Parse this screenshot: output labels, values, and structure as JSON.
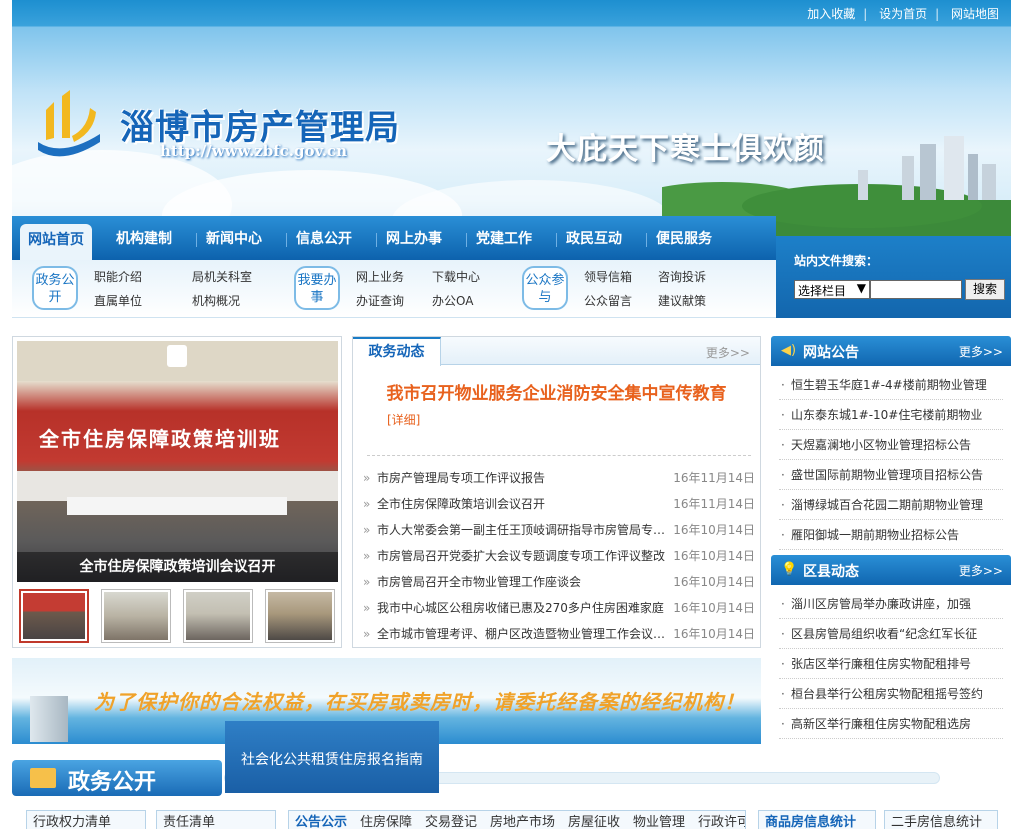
{
  "top_links": [
    "加入收藏",
    "设为首页",
    "网站地图"
  ],
  "header": {
    "title": "淄博市房产管理局",
    "url": "http://www.zbfc.gov.cn",
    "slogan": "大庇天下寒士俱欢颜"
  },
  "nav": {
    "items": [
      "网站首页",
      "机构建制",
      "新闻中心",
      "信息公开",
      "网上办事",
      "党建工作",
      "政民互动",
      "便民服务"
    ],
    "active": "网站首页"
  },
  "subnav": {
    "groups": [
      {
        "label": "政务公开",
        "links": [
          "职能介绍",
          "局机关科室",
          "直属单位",
          "机构概况"
        ]
      },
      {
        "label": "我要办事",
        "links": [
          "网上业务",
          "下载中心",
          "办证查询",
          "办公OA"
        ]
      },
      {
        "label": "公众参与",
        "links": [
          "领导信箱",
          "咨询投诉",
          "公众留言",
          "建议献策"
        ]
      }
    ]
  },
  "search": {
    "label": "站内文件搜索：",
    "select_value": "选择栏目",
    "button": "搜索"
  },
  "slider": {
    "banner_text": "全市住房保障政策培训班",
    "caption": "全市住房保障政策培训会议召开"
  },
  "news": {
    "tab": "政务动态",
    "more": "更多>>",
    "headline": "我市召开物业服务企业消防安全集中宣传教育",
    "detail": "[详细]",
    "items": [
      {
        "title": "市房产管理局专项工作评议报告",
        "date": "16年11月14日"
      },
      {
        "title": "全市住房保障政策培训会议召开",
        "date": "16年11月14日"
      },
      {
        "title": "市人大常委会第一副主任王顶岐调研指导市房管局专项工作",
        "date": "16年10月14日"
      },
      {
        "title": "市房管局召开党委扩大会议专题调度专项工作评议整改",
        "date": "16年10月14日"
      },
      {
        "title": "市房管局召开全市物业管理工作座谈会",
        "date": "16年10月14日"
      },
      {
        "title": "我市中心城区公租房收储已惠及270多户住房困难家庭",
        "date": "16年10月14日"
      },
      {
        "title": "全市城市管理考评、棚户区改造暨物业管理工作会议召开",
        "date": "16年10月14日"
      }
    ]
  },
  "notice": {
    "title": "网站公告",
    "more": "更多>>",
    "items": [
      "恒生碧玉华庭1#-4#楼前期物业管理",
      "山东泰东城1#-10#住宅楼前期物业",
      "天煜嘉澜地小区物业管理招标公告",
      "盛世国际前期物业管理项目招标公告",
      "淄博绿城百合花园二期前期物业管理",
      "雁阳御城一期前期物业招标公告"
    ]
  },
  "district": {
    "title": "区县动态",
    "more": "更多>>",
    "items": [
      "淄川区房管局举办廉政讲座，加强",
      "区县房管局组织收看“纪念红军长征",
      "张店区举行廉租住房实物配租排号",
      "桓台县举行公租房实物配租摇号签约",
      "高新区举行廉租住房实物配租选房"
    ]
  },
  "ad": {
    "text": "为了保护你的合法权益，在买房或卖房时，请委托经备案的经纪机构！"
  },
  "popup": {
    "text": "社会化公共租赁住房报名指南"
  },
  "section": {
    "title": "政务公开"
  },
  "bottom_tabs": {
    "t1": "行政权力清单",
    "t2": "责任清单",
    "t3_active": "公告公示",
    "t3_rest": "住房保障　交易登记　房地产市场　房屋征收　物业管理　行政许可",
    "t4": "商品房信息统计",
    "t5": "二手房信息统计"
  }
}
